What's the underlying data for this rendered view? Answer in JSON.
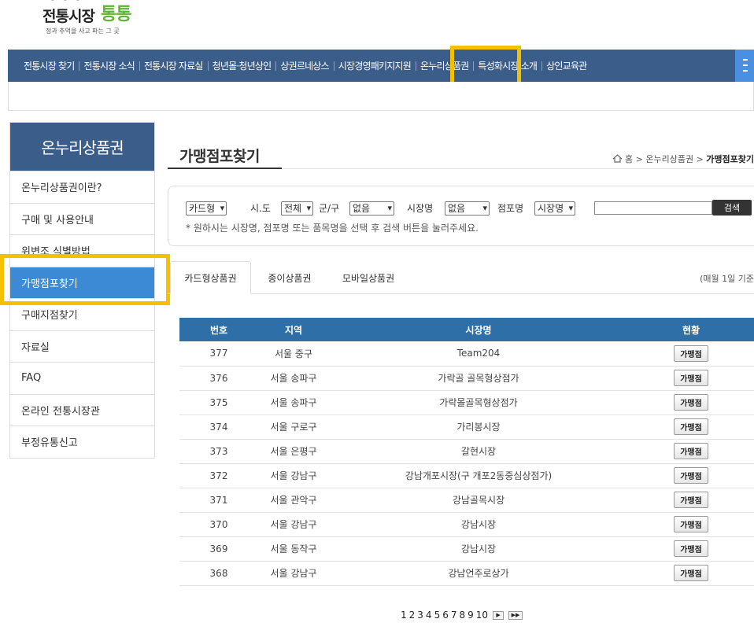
{
  "logo": {
    "title": "전통시장",
    "brand": "통통",
    "tagline": "정과 추억을 사고 파는 그 곳"
  },
  "gnb": {
    "items": [
      "전통시장 찾기",
      "전통시장 소식",
      "전통시장 자료실",
      "청년몰·청년상인",
      "상권르네상스",
      "시장경영패키지지원",
      "온누리상품권",
      "특성화시장 소개",
      "상인교육관"
    ],
    "highlighted": "온누리상품권"
  },
  "sidebar": {
    "title": "온누리상품권",
    "items": [
      "온누리상품권이란?",
      "구매 및 사용안내",
      "위변조 식별방법",
      "가맹점포찾기",
      "구매지점찾기",
      "자료실",
      "FAQ",
      "온라인 전통시장관",
      "부정유통신고"
    ],
    "active": "가맹점포찾기"
  },
  "page": {
    "title": "가맹점포찾기"
  },
  "breadcrumb": {
    "home": "홈",
    "section": "온누리상품권",
    "current": "가맹점포찾기"
  },
  "search": {
    "card_type": "카드형",
    "sido_label": "시.도",
    "sido_value": "전체",
    "gungu_label": "군/구",
    "gungu_value": "없음",
    "market_label": "시장명",
    "market_value": "없음",
    "store_label": "점포명",
    "store_value": "시장명",
    "keyword": "",
    "button": "검색",
    "hint": "* 원하시는 시장명, 점포명 또는 품목명을 선택 후 검색 버튼을 눌러주세요."
  },
  "tabs": {
    "items": [
      "카드형상품권",
      "종이상품권",
      "모바일상품권"
    ],
    "active": "카드형상품권",
    "note": "(매월 1일 기준"
  },
  "table": {
    "headers": [
      "번호",
      "지역",
      "시장명",
      "현황"
    ],
    "rows": [
      {
        "no": "377",
        "region": "서울 중구",
        "market": "Team204",
        "status": "가맹점"
      },
      {
        "no": "376",
        "region": "서울 송파구",
        "market": "가락골 골목형상점가",
        "status": "가맹점"
      },
      {
        "no": "375",
        "region": "서울 송파구",
        "market": "가락몰골목형상점가",
        "status": "가맹점"
      },
      {
        "no": "374",
        "region": "서울 구로구",
        "market": "가리봉시장",
        "status": "가맹점"
      },
      {
        "no": "373",
        "region": "서울 은평구",
        "market": "갈현시장",
        "status": "가맹점"
      },
      {
        "no": "372",
        "region": "서울 강남구",
        "market": "강남개포시장(구 개포2동중심상점가)",
        "status": "가맹점"
      },
      {
        "no": "371",
        "region": "서울 관악구",
        "market": "강남골목시장",
        "status": "가맹점"
      },
      {
        "no": "370",
        "region": "서울 강남구",
        "market": "강남시장",
        "status": "가맹점"
      },
      {
        "no": "369",
        "region": "서울 동작구",
        "market": "강남시장",
        "status": "가맹점"
      },
      {
        "no": "368",
        "region": "서울 강남구",
        "market": "강남언주로상가",
        "status": "가맹점"
      }
    ]
  },
  "pagination": {
    "pages": [
      "1",
      "2",
      "3",
      "4",
      "5",
      "6",
      "7",
      "8",
      "9",
      "10"
    ],
    "next": "▶",
    "last": "▶▶"
  },
  "colors": {
    "nav": "#3b5d8a",
    "active": "#3c8ad6",
    "table_head": "#2f6fa8",
    "highlight": "#f5c000"
  }
}
